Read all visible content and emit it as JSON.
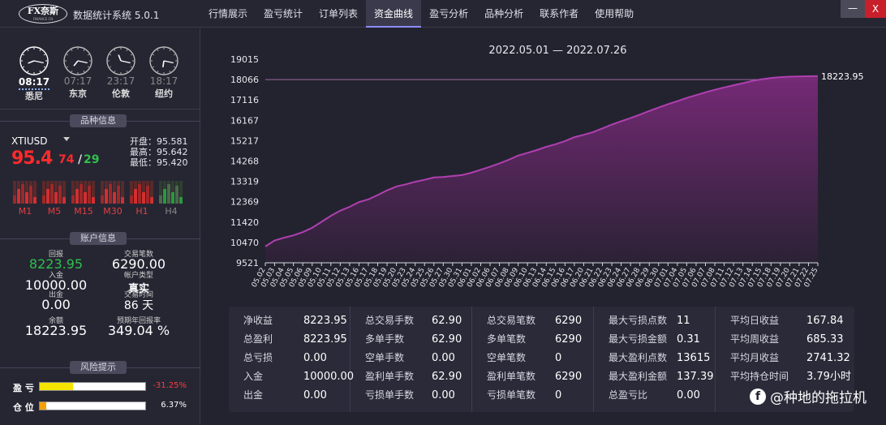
{
  "app": {
    "logo_text": "FX奈斯",
    "logo_sub": "FINANCE CN",
    "title": "数据统计系统 5.0.1",
    "window_min": "—",
    "window_close": "X"
  },
  "nav": [
    {
      "label": "行情展示",
      "active": false
    },
    {
      "label": "盈亏统计",
      "active": false
    },
    {
      "label": "订单列表",
      "active": false
    },
    {
      "label": "资金曲线",
      "active": true
    },
    {
      "label": "盈亏分析",
      "active": false
    },
    {
      "label": "品种分析",
      "active": false
    },
    {
      "label": "联系作者",
      "active": false
    },
    {
      "label": "使用帮助",
      "active": false
    }
  ],
  "clocks": [
    {
      "time": "08:17",
      "city": "悉尼",
      "active": true,
      "icon": "clock-icon"
    },
    {
      "time": "07:17",
      "city": "东京",
      "active": false,
      "icon": "clock-icon"
    },
    {
      "time": "23:17",
      "city": "伦敦",
      "active": false,
      "icon": "clock-icon"
    },
    {
      "time": "18:17",
      "city": "纽约",
      "active": false,
      "icon": "clock-icon"
    }
  ],
  "symbol_info": {
    "section_title": "品种信息",
    "symbol": "XTIUSD",
    "price_main": "95.4",
    "price_small_1": "74",
    "price_sep": "/",
    "price_small_2": "29",
    "open": "开盘：95.581",
    "high": "最高：95.642",
    "low": "最低：95.420",
    "timeframes": [
      {
        "label": "M1",
        "active": true
      },
      {
        "label": "M5",
        "active": true
      },
      {
        "label": "M15",
        "active": true
      },
      {
        "label": "M30",
        "active": true
      },
      {
        "label": "H1",
        "active": true
      },
      {
        "label": "H4",
        "active": false
      }
    ],
    "colors": {
      "up": "#ff2a2a",
      "down": "#2ec04a"
    }
  },
  "account": {
    "section_title": "账户信息",
    "items": [
      {
        "label": "回报",
        "value": "8223.95",
        "color": "#2ec04a"
      },
      {
        "label": "交易笔数",
        "value": "6290.00",
        "color": "#ffffff"
      },
      {
        "label": "入金",
        "value": "10000.00",
        "color": "#ffffff"
      },
      {
        "label": "帐户类型",
        "value": "真实",
        "color": "#ffffff"
      },
      {
        "label": "出金",
        "value": "0.00",
        "color": "#ffffff"
      },
      {
        "label": "交易时间",
        "value": "86 天",
        "color": "#ffffff"
      },
      {
        "label": "余额",
        "value": "18223.95",
        "color": "#ffffff"
      },
      {
        "label": "预期年回报率",
        "value": "349.04 %",
        "color": "#ffffff"
      }
    ]
  },
  "risk": {
    "section_title": "风险提示",
    "items": [
      {
        "label": "盈 亏",
        "value": "-31.25%",
        "fraction": 0.3125,
        "fill": "#f5e400",
        "text_color": "#ff3a3a"
      },
      {
        "label": "仓 位",
        "value": "6.37%",
        "fraction": 0.0637,
        "fill": "#f5a000",
        "text_color": "#ffffff"
      }
    ]
  },
  "chart_data": {
    "type": "area",
    "title": "2022.05.01 — 2022.07.26",
    "xlabel": "",
    "ylabel": "",
    "y_ticks": [
      9521,
      10470,
      11420,
      12369,
      13319,
      14268,
      15217,
      16167,
      17116,
      18066,
      19015
    ],
    "ylim": [
      9521,
      19015
    ],
    "end_label": "18223.95",
    "reference_line": 18066,
    "x": [
      "05.02",
      "05.03",
      "05.04",
      "05.05",
      "05.06",
      "05.09",
      "05.10",
      "05.11",
      "05.12",
      "05.13",
      "05.16",
      "05.17",
      "05.18",
      "05.19",
      "05.20",
      "05.23",
      "05.24",
      "05.25",
      "05.26",
      "05.27",
      "05.30",
      "05.31",
      "06.01",
      "06.02",
      "06.06",
      "06.07",
      "06.08",
      "06.09",
      "06.10",
      "06.13",
      "06.14",
      "06.15",
      "06.16",
      "06.17",
      "06.20",
      "06.21",
      "06.22",
      "06.23",
      "06.24",
      "06.27",
      "06.28",
      "06.29",
      "06.30",
      "07.01",
      "07.04",
      "07.05",
      "07.06",
      "07.07",
      "07.08",
      "07.11",
      "07.12",
      "07.13",
      "07.14",
      "07.15",
      "07.18",
      "07.19",
      "07.20",
      "07.21",
      "07.22",
      "07.25"
    ],
    "series": [
      {
        "values": [
          10280,
          10560,
          10690,
          10800,
          10950,
          11150,
          11430,
          11710,
          11950,
          12130,
          12350,
          12480,
          12680,
          12900,
          13080,
          13180,
          13300,
          13390,
          13500,
          13520,
          13570,
          13610,
          13720,
          13860,
          14000,
          14160,
          14330,
          14520,
          14650,
          14780,
          14930,
          15050,
          15200,
          15380,
          15490,
          15620,
          15790,
          15970,
          16120,
          16270,
          16430,
          16600,
          16760,
          16920,
          17060,
          17210,
          17340,
          17470,
          17590,
          17700,
          17800,
          17900,
          18000,
          18080,
          18140,
          18180,
          18200,
          18210,
          18220,
          18223.95
        ]
      }
    ],
    "colors": {
      "line": "#b040b0",
      "fill_top": "#7a2a7a",
      "fill_bottom": "#2c2236"
    },
    "grid": false,
    "legend": "none"
  },
  "stats": {
    "columns": [
      [
        {
          "key": "净收益",
          "value": "8223.95"
        },
        {
          "key": "总盈利",
          "value": "8223.95"
        },
        {
          "key": "总亏损",
          "value": "0.00"
        },
        {
          "key": "入金",
          "value": "10000.00"
        },
        {
          "key": "出金",
          "value": "0.00"
        }
      ],
      [
        {
          "key": "总交易手数",
          "value": "62.90"
        },
        {
          "key": "多单手数",
          "value": "62.90"
        },
        {
          "key": "空单手数",
          "value": "0.00"
        },
        {
          "key": "盈利单手数",
          "value": "62.90"
        },
        {
          "key": "亏损单手数",
          "value": "0.00"
        }
      ],
      [
        {
          "key": "总交易笔数",
          "value": "6290"
        },
        {
          "key": "多单笔数",
          "value": "6290"
        },
        {
          "key": "空单笔数",
          "value": "0"
        },
        {
          "key": "盈利单笔数",
          "value": "6290"
        },
        {
          "key": "亏损单笔数",
          "value": "0"
        }
      ],
      [
        {
          "key": "最大亏损点数",
          "value": "11"
        },
        {
          "key": "最大亏损金额",
          "value": "0.31"
        },
        {
          "key": "最大盈利点数",
          "value": "13615"
        },
        {
          "key": "最大盈利金额",
          "value": "137.39"
        },
        {
          "key": "总盈亏比",
          "value": "0.00"
        }
      ],
      [
        {
          "key": "平均日收益",
          "value": "167.84"
        },
        {
          "key": "平均周收益",
          "value": "685.33"
        },
        {
          "key": "平均月收益",
          "value": "2741.32"
        },
        {
          "key": "平均持仓时间",
          "value": "3.79小时"
        }
      ]
    ]
  },
  "watermark": {
    "icon": "zhihu-icon",
    "text": "@种地的拖拉机"
  }
}
